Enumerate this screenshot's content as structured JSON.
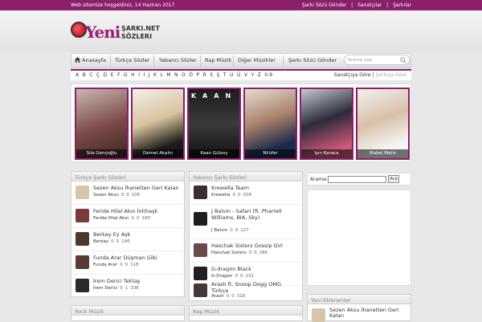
{
  "topbar": {
    "welcome": "Web sitemize hoşgeldiniz, 14 Haziran 2017",
    "links": [
      "Şarkı Sözü Gönder",
      "|",
      "Sanatçılar",
      "|",
      "Şarkılar"
    ]
  },
  "logo": {
    "big": "Yeni",
    "line1": "ŞARKI.NET",
    "line2": "SÖZLERI"
  },
  "nav": {
    "items": [
      "Anasayfa",
      "Türkçe Sözler",
      "Yabancı Sözler",
      "Rap Müzik",
      "Diğer Müzikler",
      "Şarkı Sözü Gönder"
    ],
    "search_placeholder": "Arama yap"
  },
  "alphabet": [
    "A",
    "B",
    "C",
    "Ç",
    "D",
    "E",
    "F",
    "G",
    "H",
    "I",
    "İ",
    "J",
    "K",
    "L",
    "M",
    "N",
    "O",
    "Ö",
    "P",
    "R",
    "S",
    "Ş",
    "T",
    "U",
    "Ü",
    "V",
    "Y",
    "Z",
    "0-9"
  ],
  "alpha_right": {
    "active": "Sanatçıya Göre",
    "sep": "|",
    "muted": "Şarkıya Göre"
  },
  "artists": [
    "Sıla Gençoğlu",
    "Demet Akalın",
    "Kaan Gülsoy",
    "Nilüfer",
    "Işın Karaca",
    "Mabel Matiz"
  ],
  "artist_banner_text": "KAAN",
  "turkish": {
    "title": "Türkçe Şarkı Sözleri",
    "songs": [
      {
        "title": "Sezen Aksu İhanetten Geri Kalan",
        "artist": "Sezen Aksu",
        "c": "0",
        "l": "0",
        "v": "106"
      },
      {
        "title": "Feride Hilal Akın İntihaşk",
        "artist": "Feride Hilal Akın",
        "c": "0",
        "l": "0",
        "v": "180"
      },
      {
        "title": "Berkay Ey Aşk",
        "artist": "Berkay",
        "c": "0",
        "l": "0",
        "v": "146"
      },
      {
        "title": "Funda Arar Düşman Gibi",
        "artist": "Funda Arar",
        "c": "0",
        "l": "0",
        "v": "118"
      },
      {
        "title": "İrem Derici Tektaş",
        "artist": "İrem Derici",
        "c": "0",
        "l": "1",
        "v": "338"
      }
    ]
  },
  "foreign": {
    "title": "Yabancı Şarkı Sözleri",
    "songs": [
      {
        "title": "Krewella Team",
        "artist": "Krewella",
        "c": "0",
        "l": "0",
        "v": "208"
      },
      {
        "title": "J Balvin - Safari (ft. Pharrell Williams, BIA, Sky)",
        "artist": "J Balvin",
        "c": "0",
        "l": "0",
        "v": "227"
      },
      {
        "title": "Haschak Sisters Gossip Girl",
        "artist": "Haschak Sisters",
        "c": "0",
        "l": "0",
        "v": "286"
      },
      {
        "title": "G-dragon Black",
        "artist": "G-Dragon",
        "c": "0",
        "l": "0",
        "v": "231"
      },
      {
        "title": "Arash ft. Snoop Dogg OMG Türkçe",
        "artist": "Arash",
        "c": "0",
        "l": "0",
        "v": "316"
      }
    ]
  },
  "rock": {
    "title": "Rock Müzik"
  },
  "rap": {
    "title": "Rap Müzik"
  },
  "sidebar_search": {
    "label": "Arama:",
    "button": "Ara"
  },
  "new_added": {
    "title": "Yeni Eklenenler",
    "first": "Sezen Aksu İhanetten Geri Kalan"
  },
  "colors": {
    "brand": "#8b1f6b"
  }
}
